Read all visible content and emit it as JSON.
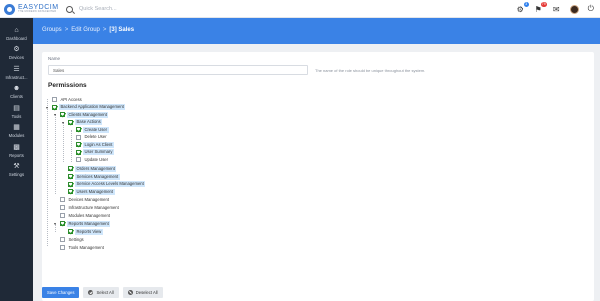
{
  "app": {
    "logo_name": "EASYDCIM",
    "logo_sub": "THE MODERN DATACENTER"
  },
  "search": {
    "placeholder": "Quick Search..."
  },
  "topbar": {
    "badge_1": "3",
    "badge_2": "79"
  },
  "sidebar": {
    "items": [
      {
        "label": "Dashboard",
        "icon": "home-icon"
      },
      {
        "label": "Devices",
        "icon": "gear-icon"
      },
      {
        "label": "Infrastruct...",
        "icon": "sitemap-icon"
      },
      {
        "label": "Clients",
        "icon": "users-icon"
      },
      {
        "label": "Tools",
        "icon": "document-icon"
      },
      {
        "label": "Modules",
        "icon": "grid-icon"
      },
      {
        "label": "Reports",
        "icon": "chart-icon"
      },
      {
        "label": "Settings",
        "icon": "wrench-icon"
      }
    ]
  },
  "breadcrumb": {
    "root": "Groups",
    "middle": "Edit Group",
    "current": "[3] Sales",
    "sep": ">"
  },
  "form": {
    "name_label": "Name",
    "name_value": "Sales",
    "name_help": "The name of the role should be unique throughout the system.",
    "permissions_title": "Permissions"
  },
  "tree": [
    {
      "label": "API Access",
      "checked": false,
      "selected": false
    },
    {
      "label": "Backend Application Management",
      "checked": true,
      "selected": true
    },
    {
      "label": "Clients Management",
      "checked": true,
      "selected": true
    },
    {
      "label": "Base Actions",
      "checked": true,
      "selected": true
    },
    {
      "label": "Create User",
      "checked": true,
      "selected": true
    },
    {
      "label": "Delete User",
      "checked": false,
      "selected": false
    },
    {
      "label": "Login As Client",
      "checked": true,
      "selected": true
    },
    {
      "label": "User Summary",
      "checked": true,
      "selected": true
    },
    {
      "label": "Update User",
      "checked": false,
      "selected": false
    },
    {
      "label": "Orders Management",
      "checked": true,
      "selected": true
    },
    {
      "label": "Services Management",
      "checked": true,
      "selected": true
    },
    {
      "label": "Service Access Levels Management",
      "checked": true,
      "selected": true
    },
    {
      "label": "Users Management",
      "checked": true,
      "selected": true
    },
    {
      "label": "Devices Management",
      "checked": false,
      "selected": false
    },
    {
      "label": "Infrastructure Management",
      "checked": false,
      "selected": false
    },
    {
      "label": "Modules Management",
      "checked": false,
      "selected": false
    },
    {
      "label": "Reports Management",
      "checked": true,
      "selected": true
    },
    {
      "label": "Reports View",
      "checked": true,
      "selected": true
    },
    {
      "label": "Settings",
      "checked": false,
      "selected": false
    },
    {
      "label": "Tools Management",
      "checked": false,
      "selected": false
    }
  ],
  "footer": {
    "save": "Save Changes",
    "select_all": "Select All",
    "deselect_all": "Deselect All"
  },
  "colors": {
    "accent": "#3a82e6",
    "sidebar": "#1f2937",
    "selected_bg": "#cfe6fb",
    "check": "#1e8e1e"
  }
}
